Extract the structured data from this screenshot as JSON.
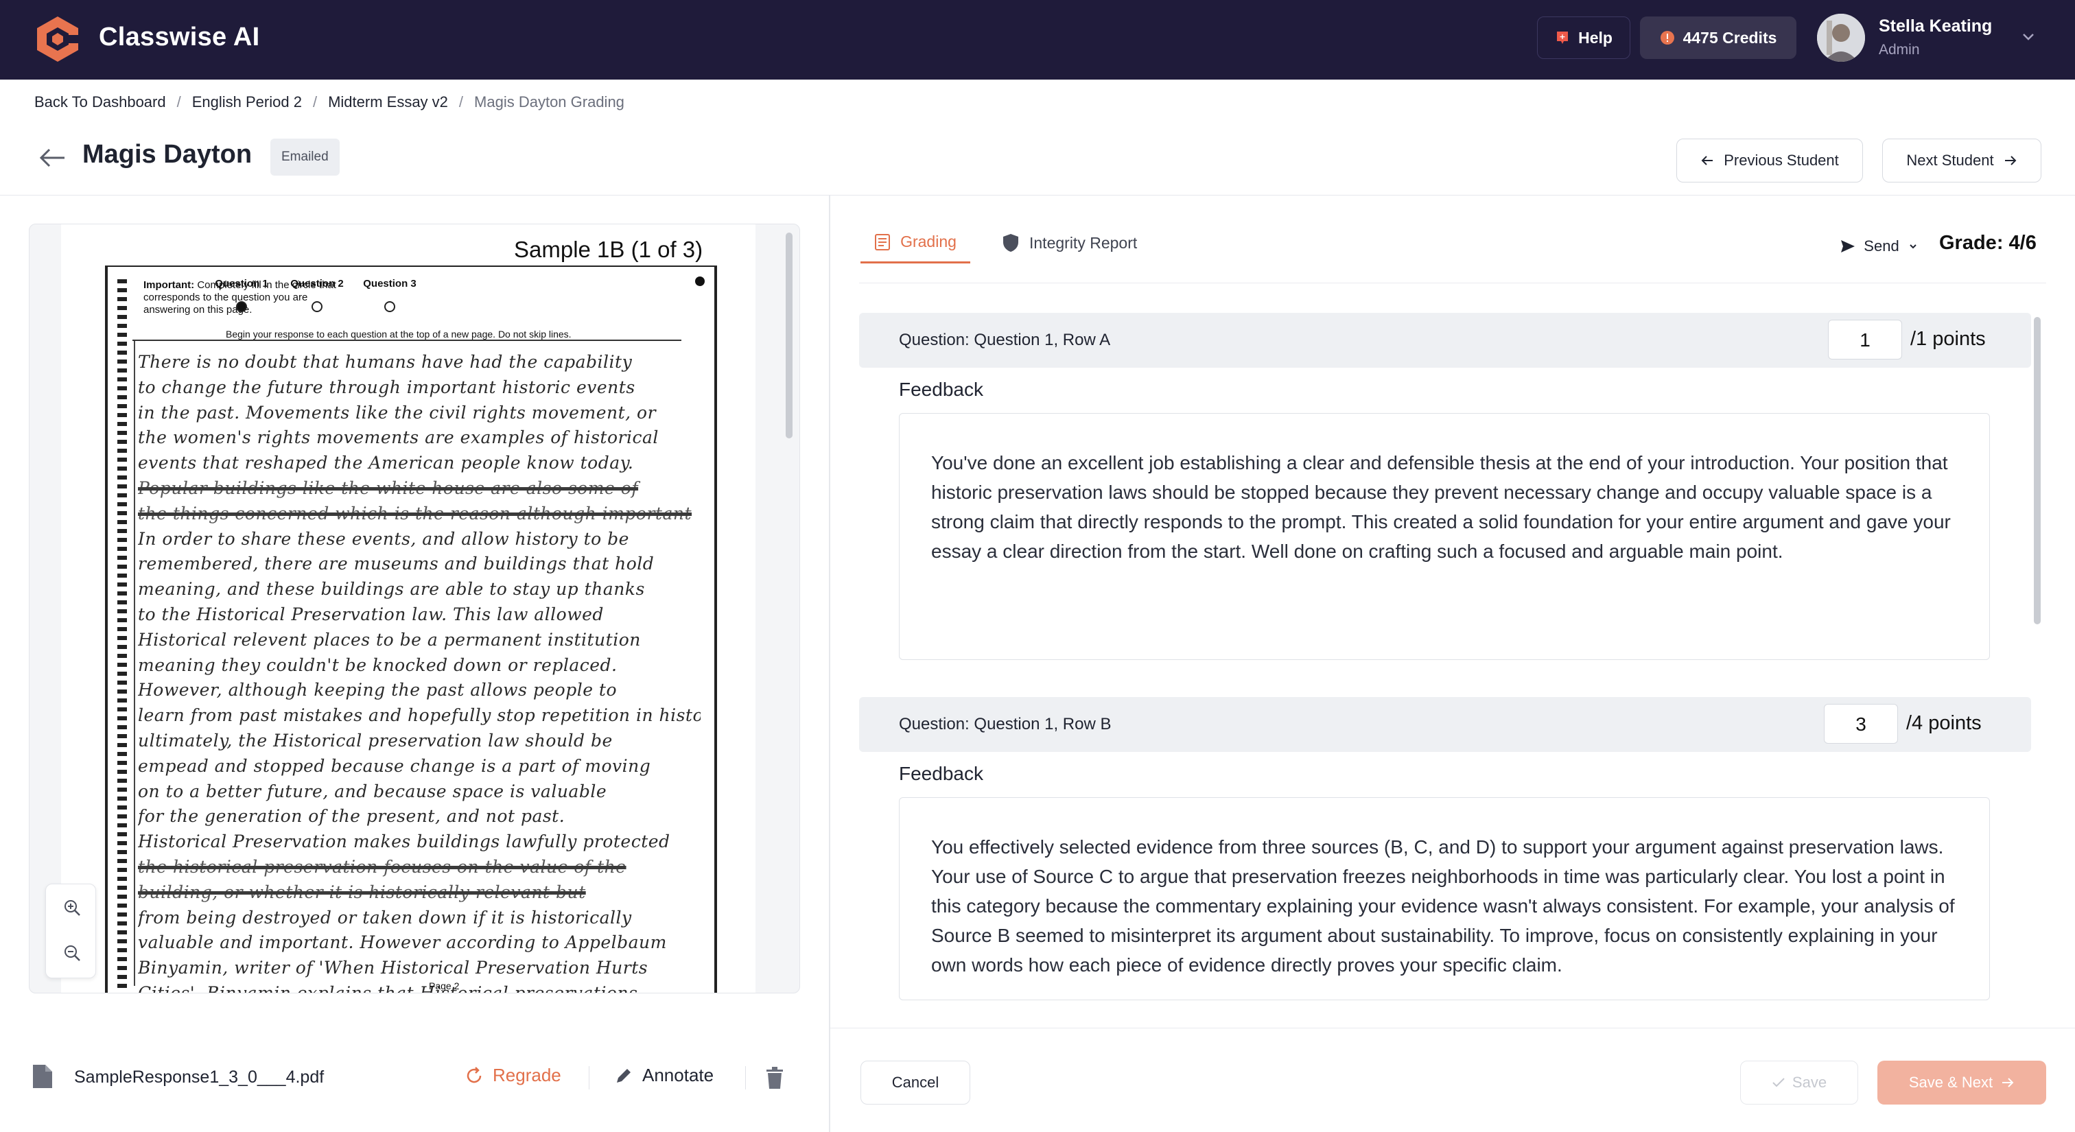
{
  "app": {
    "name": "Classwise AI",
    "colors": {
      "topbar": "#1f1b3a",
      "accent": "#e2704a",
      "accent_light": "#f2b29f"
    }
  },
  "topbar": {
    "help_label": "Help",
    "credits_label": "4475 Credits",
    "user_name": "Stella Keating",
    "user_role": "Admin"
  },
  "breadcrumb": [
    "Back To Dashboard",
    "English Period 2",
    "Midterm Essay v2",
    "Magis Dayton Grading"
  ],
  "student": {
    "name": "Magis Dayton",
    "status": "Emailed"
  },
  "nav": {
    "previous": "Previous Student",
    "next": "Next Student"
  },
  "document": {
    "sample_title": "Sample 1B (1 of 3)",
    "important_bold": "Important:",
    "important_text": "Completely fill in the circle that corresponds to the question you are answering on this page.",
    "questions": [
      "Question 1",
      "Question 2",
      "Question 3"
    ],
    "selected_question": "Question 1",
    "instruction": "Begin your response to each question at the top of a new page. Do not skip lines.",
    "handwriting_lines": [
      "There is no doubt that humans have had the capability",
      "to change the future through important historic events",
      "in the past. Movements like the civil rights movement, or",
      "the women's rights movements are examples of historical",
      "events that reshaped the American people know today.",
      "Popular buildings like the white house are also some of",
      "the things concerned which is the reason although important",
      "In order to share these events, and allow history to be",
      "remembered, there are museums and buildings that hold",
      "meaning, and these buildings are able to stay up thanks",
      "to the Historical Preservation law. This law allowed",
      "Historical relevent places to be a permanent institution",
      "meaning they couldn't be knocked down or replaced.",
      "However, although keeping the past allows people to",
      "learn from past mistakes and hopefully stop repetition in history",
      "ultimately, the Historical preservation law should be",
      "empead and stopped because change is a part of moving",
      "on to a better future, and because space is valuable",
      "for the generation of the present, and not past.",
      "Historical Preservation makes buildings lawfully protected",
      "the historical preservation focuses on the value of the",
      "building, or whether it is historically relevant but",
      "from being destroyed or taken down if it is historically",
      "valuable and important. However according to Appelbaum",
      "Binyamin, writer of 'When Historical Preservation Hurts",
      "Cities', Binyamin explains that Historical preservations"
    ],
    "struck_lines": [
      5,
      6,
      20,
      21
    ],
    "page_label": "Page 2"
  },
  "file_bar": {
    "file_name": "SampleResponse1_3_0___4.pdf",
    "regrade": "Regrade",
    "annotate": "Annotate"
  },
  "tabs": {
    "grading": "Grading",
    "integrity": "Integrity Report",
    "active": "Grading"
  },
  "grading": {
    "send_label": "Send",
    "grade": "Grade: 4/6"
  },
  "questions": [
    {
      "title": "Question: Question 1, Row A",
      "points": "1",
      "max_label": "/1 points",
      "feedback_label": "Feedback",
      "feedback": "You've done an excellent job establishing a clear and defensible thesis at the end of your introduction. Your position that historic preservation laws should be stopped because they prevent necessary change and occupy valuable space is a strong claim that directly responds to the prompt. This created a solid foundation for your entire argument and gave your essay a clear direction from the start. Well done on crafting such a focused and arguable main point."
    },
    {
      "title": "Question: Question 1, Row B",
      "points": "3",
      "max_label": "/4 points",
      "feedback_label": "Feedback",
      "feedback": "You effectively selected evidence from three sources (B, C, and D) to support your argument against preservation laws. Your use of Source C to argue that preservation freezes neighborhoods in time was particularly clear. You lost a point in this category because the commentary explaining your evidence wasn't always consistent. For example, your analysis of Source B seemed to misinterpret its argument about sustainability. To improve, focus on consistently explaining in your own words how each piece of evidence directly proves your specific claim."
    }
  ],
  "footer": {
    "cancel": "Cancel",
    "save": "Save",
    "save_next": "Save & Next"
  }
}
